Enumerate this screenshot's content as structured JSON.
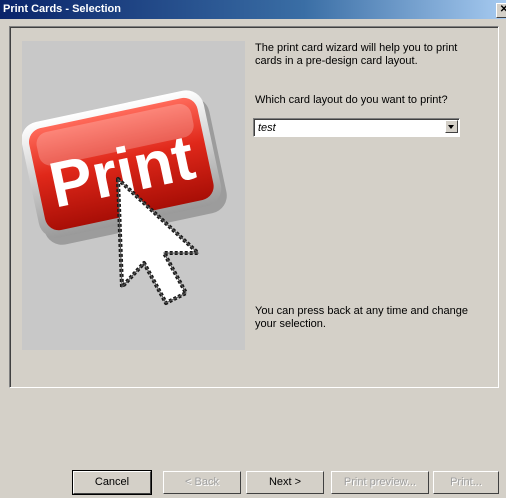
{
  "window": {
    "title": "Print Cards - Selection"
  },
  "wizard": {
    "intro": "The print card wizard will help you to print cards in a pre-design card layout.",
    "question": "Which card layout do you want to print?",
    "layout_select": {
      "value": "test"
    },
    "note": "You can press back at any time and change your selection.",
    "image_text": "Print"
  },
  "buttons": {
    "cancel": "Cancel",
    "back": "< Back",
    "next": "Next >",
    "print_preview": "Print preview...",
    "print": "Print..."
  }
}
